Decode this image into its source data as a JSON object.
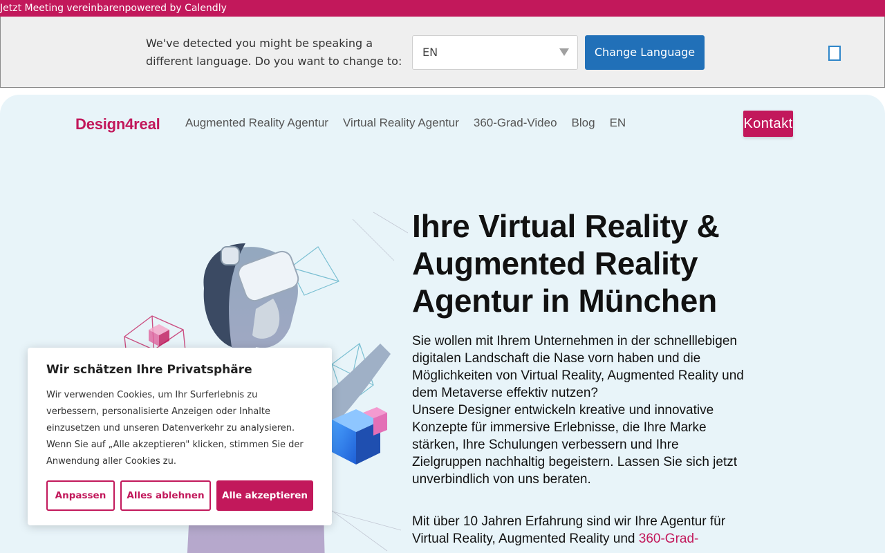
{
  "calendly_bar": {
    "text": "Jetzt Meeting vereinbarenpowered by Calendly"
  },
  "language_banner": {
    "message": "We've detected you might be speaking a different language. Do you want to change to:",
    "selected_language": "EN",
    "change_button": "Change Language"
  },
  "header": {
    "logo": "Design4real",
    "nav": [
      {
        "label": "Augmented Reality Agentur"
      },
      {
        "label": "Virtual Reality Agentur"
      },
      {
        "label": "360-Grad-Video"
      },
      {
        "label": "Blog"
      },
      {
        "label": "EN"
      }
    ],
    "contact_button": "Kontakt"
  },
  "hero": {
    "title": "Ihre Virtual Reality & Augmented Reality Agentur in München",
    "paragraph1": "Sie wollen mit Ihrem Unternehmen in der schnelllebigen digitalen Landschaft die Nase vorn haben und die Möglichkeiten von Virtual Reality, Augmented Reality und dem Metaverse effektiv nutzen?",
    "paragraph1b": "Unsere Designer entwickeln kreative und innovative Konzepte für immersive Erlebnisse, die Ihre Marke stärken, Ihre Schulungen verbessern und Ihre Zielgruppen nachhaltig begeistern. Lassen Sie sich jetzt unverbindlich von uns beraten.",
    "paragraph2_start": "Mit über 10 Jahren Erfahrung sind wir Ihre Agentur für Virtual Reality, Augmented Reality und ",
    "paragraph2_link": "360-Grad-"
  },
  "cookie_banner": {
    "title": "Wir schätzen Ihre Privatsphäre",
    "text": "Wir verwenden Cookies, um Ihr Surferlebnis zu verbessern, personalisierte Anzeigen oder Inhalte einzusetzen und unseren Datenverkehr zu analysieren. Wenn Sie auf „Alle akzeptieren\" klicken, stimmen Sie der Anwendung aller Cookies zu.",
    "customize": "Anpassen",
    "reject_all": "Alles ablehnen",
    "accept_all": "Alle akzeptieren"
  },
  "colors": {
    "brand": "#c2185b",
    "banner_button": "#2170b8",
    "page_bg": "#e8f4f9"
  }
}
